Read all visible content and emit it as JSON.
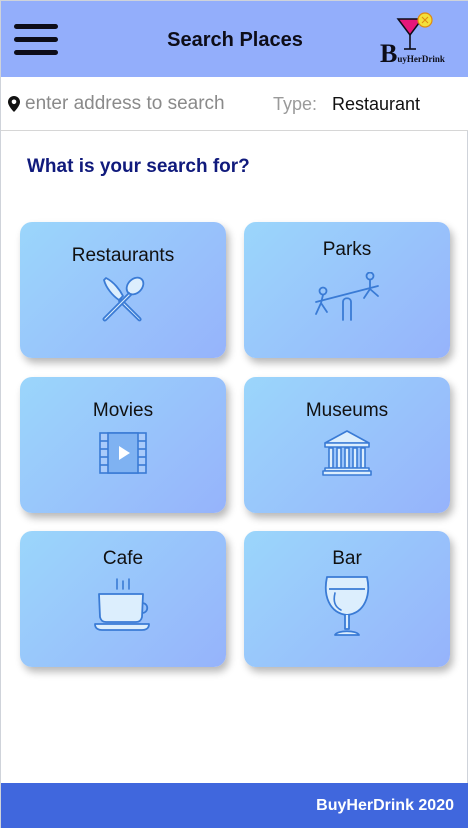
{
  "header": {
    "title": "Search Places"
  },
  "logo": {
    "initial": "B",
    "rest": "uyHerDrink"
  },
  "search": {
    "placeholder": "enter address to search",
    "type_label": "Type:",
    "type_value": "Restaurant"
  },
  "main": {
    "question": "What is your search for?",
    "categories": [
      {
        "label": "Restaurants",
        "icon": "fork-knife-icon"
      },
      {
        "label": "Parks",
        "icon": "seesaw-icon"
      },
      {
        "label": "Movies",
        "icon": "film-icon"
      },
      {
        "label": "Museums",
        "icon": "museum-icon"
      },
      {
        "label": "Cafe",
        "icon": "coffee-cup-icon"
      },
      {
        "label": "Bar",
        "icon": "wine-glass-icon"
      }
    ]
  },
  "footer": {
    "text": "BuyHerDrink 2020"
  },
  "colors": {
    "header": "#93aefb",
    "footer": "#4067dd",
    "heading": "#101a7c",
    "icon_stroke": "#3a7bd5"
  }
}
